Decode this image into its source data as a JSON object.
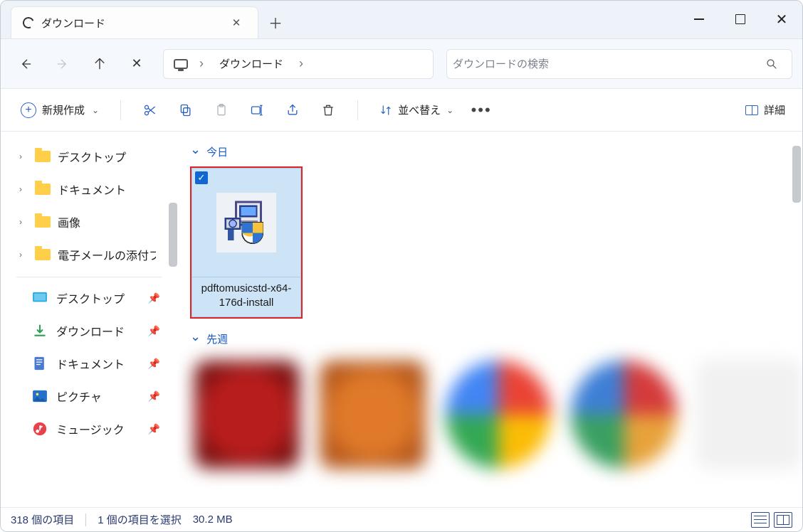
{
  "window": {
    "tab_title": "ダウンロード"
  },
  "breadcrumb": {
    "item1": "ダウンロード"
  },
  "search": {
    "placeholder": "ダウンロードの検索"
  },
  "toolbar": {
    "new_label": "新規作成",
    "sort_label": "並べ替え",
    "details_label": "詳細"
  },
  "sidebar": {
    "tree": [
      {
        "label": "デスクトップ"
      },
      {
        "label": "ドキュメント"
      },
      {
        "label": "画像"
      },
      {
        "label": "電子メールの添付ファイル"
      }
    ],
    "quick": [
      {
        "label": "デスクトップ"
      },
      {
        "label": "ダウンロード"
      },
      {
        "label": "ドキュメント"
      },
      {
        "label": "ピクチャ"
      },
      {
        "label": "ミュージック"
      }
    ]
  },
  "groups": {
    "today": "今日",
    "lastweek": "先週"
  },
  "file": {
    "name": "pdftomusicstd-x64-176d-install"
  },
  "status": {
    "count": "318 個の項目",
    "selection": "1 個の項目を選択",
    "size": "30.2 MB"
  },
  "colors": {
    "accent": "#1067d2",
    "highlight_border": "#e02424"
  }
}
